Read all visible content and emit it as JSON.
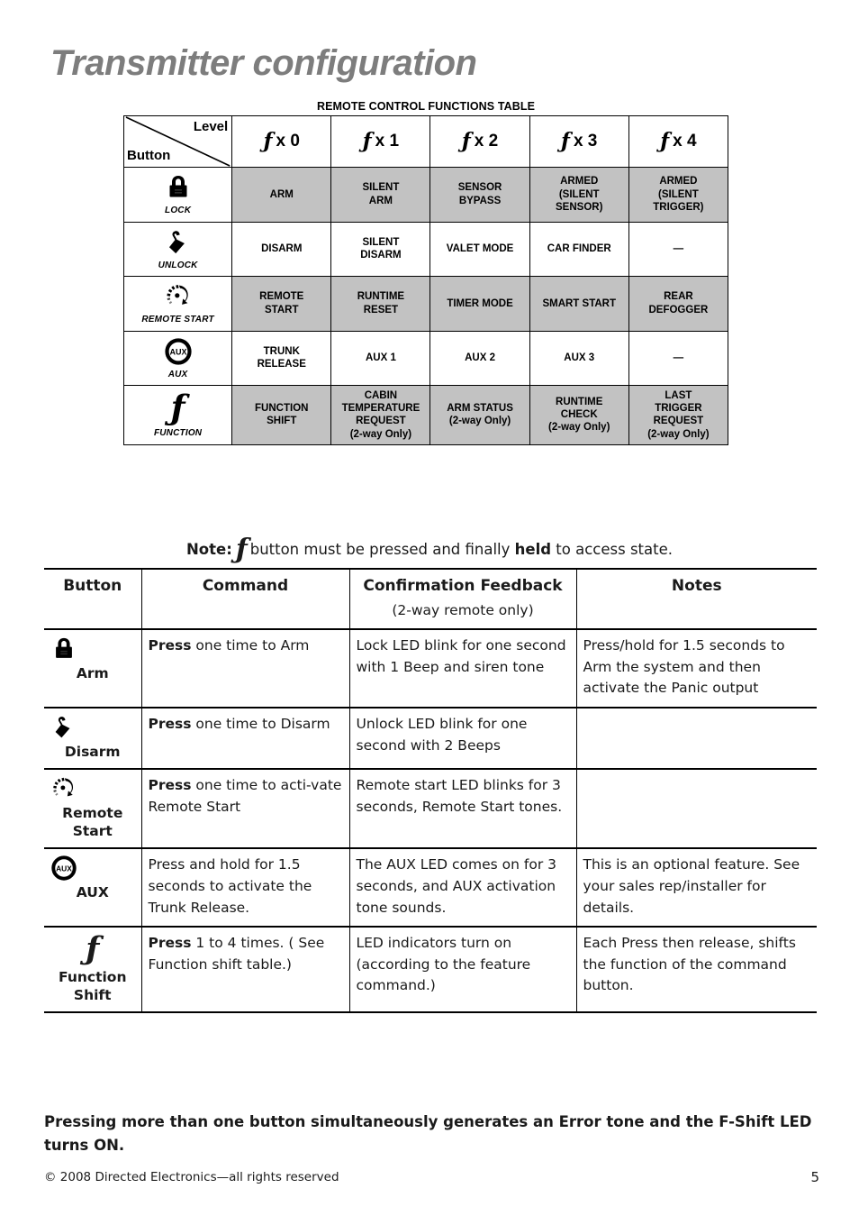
{
  "title": "Transmitter configuration",
  "functions_table": {
    "caption": "REMOTE CONTROL FUNCTIONS TABLE",
    "corner": {
      "level_label": "Level",
      "button_label": "Button"
    },
    "levels": [
      "x 0",
      "x 1",
      "x 2",
      "x 3",
      "x 4"
    ],
    "rows": [
      {
        "icon": "padlock-closed-icon",
        "icon_label": "LOCK",
        "shaded": true,
        "cells": [
          "ARM",
          "SILENT\nARM",
          "SENSOR\nBYPASS",
          "ARMED\n(SILENT\nSENSOR)",
          "ARMED\n(SILENT\nTRIGGER)"
        ]
      },
      {
        "icon": "padlock-open-icon",
        "icon_label": "UNLOCK",
        "shaded": false,
        "cells": [
          "DISARM",
          "SILENT\nDISARM",
          "VALET MODE",
          "CAR FINDER",
          "—"
        ]
      },
      {
        "icon": "remote-start-dial-icon",
        "icon_label": "REMOTE START",
        "shaded": true,
        "cells": [
          "REMOTE\nSTART",
          "RUNTIME\nRESET",
          "TIMER MODE",
          "SMART START",
          "REAR\nDEFOGGER"
        ]
      },
      {
        "icon": "aux-circle-icon",
        "icon_label": "AUX",
        "shaded": false,
        "cells": [
          "TRUNK\nRELEASE",
          "AUX 1",
          "AUX 2",
          "AUX 3",
          "—"
        ]
      },
      {
        "icon": "function-f-icon",
        "icon_label": "FUNCTION",
        "shaded": true,
        "cells": [
          "FUNCTION\nSHIFT",
          "CABIN\nTEMPERATURE\nREQUEST\n(2-way Only)",
          "ARM STATUS\n(2-way Only)",
          "RUNTIME\nCHECK\n(2-way Only)",
          "LAST\nTRIGGER\nREQUEST\n(2-way Only)"
        ]
      }
    ]
  },
  "note": {
    "prefix": "Note:",
    "f_symbol": "ƒ",
    "middle": "button must be pressed and finally",
    "bold_word": "held",
    "suffix": "to access state."
  },
  "commands_table": {
    "headers": {
      "button": "Button",
      "command": "Command",
      "feedback": "Confirmation Feedback",
      "feedback_sub": "(2-way remote only)",
      "notes": "Notes"
    },
    "rows": [
      {
        "icon": "padlock-closed-icon",
        "button_label": "Arm",
        "command_bold": "Press",
        "command_rest": " one time to Arm",
        "feedback": "Lock LED blink for one second with 1 Beep and siren tone",
        "notes": "Press/hold for 1.5 seconds to Arm the system and then activate the Panic output"
      },
      {
        "icon": "padlock-open-icon",
        "button_label": "Disarm",
        "command_bold": "Press",
        "command_rest": " one time to Disarm",
        "feedback": "Unlock LED blink for one second with 2 Beeps",
        "notes": ""
      },
      {
        "icon": "remote-start-dial-icon",
        "button_label": "Remote Start",
        "command_bold": "Press",
        "command_rest": " one time to acti-vate Remote Start",
        "feedback": "Remote start LED blinks for 3 seconds, Remote Start tones.",
        "notes": ""
      },
      {
        "icon": "aux-circle-icon",
        "button_label": "AUX",
        "command_bold": "",
        "command_rest": "Press and hold for 1.5 seconds to activate the Trunk Release.",
        "feedback": "The AUX LED comes on for 3 seconds, and AUX activation tone sounds.",
        "notes": "This is an optional feature. See your sales rep/installer for details."
      },
      {
        "icon": "function-f-icon",
        "button_label": "Function Shift",
        "command_bold": "Press",
        "command_rest": " 1 to 4 times. ( See Function shift table.)",
        "feedback": "LED indicators turn on (according to the feature command.)",
        "notes": "Each Press then release, shifts the function of the command button."
      }
    ]
  },
  "warning": "Pressing more than one button simultaneously generates an Error tone and the F-Shift LED turns ON.",
  "copyright": "© 2008 Directed Electronics—all rights reserved",
  "page_number": "5",
  "colors": {
    "title_gray": "#7d7d7d",
    "cell_shade": "#c2c2c2",
    "text": "#1a1a1a"
  }
}
